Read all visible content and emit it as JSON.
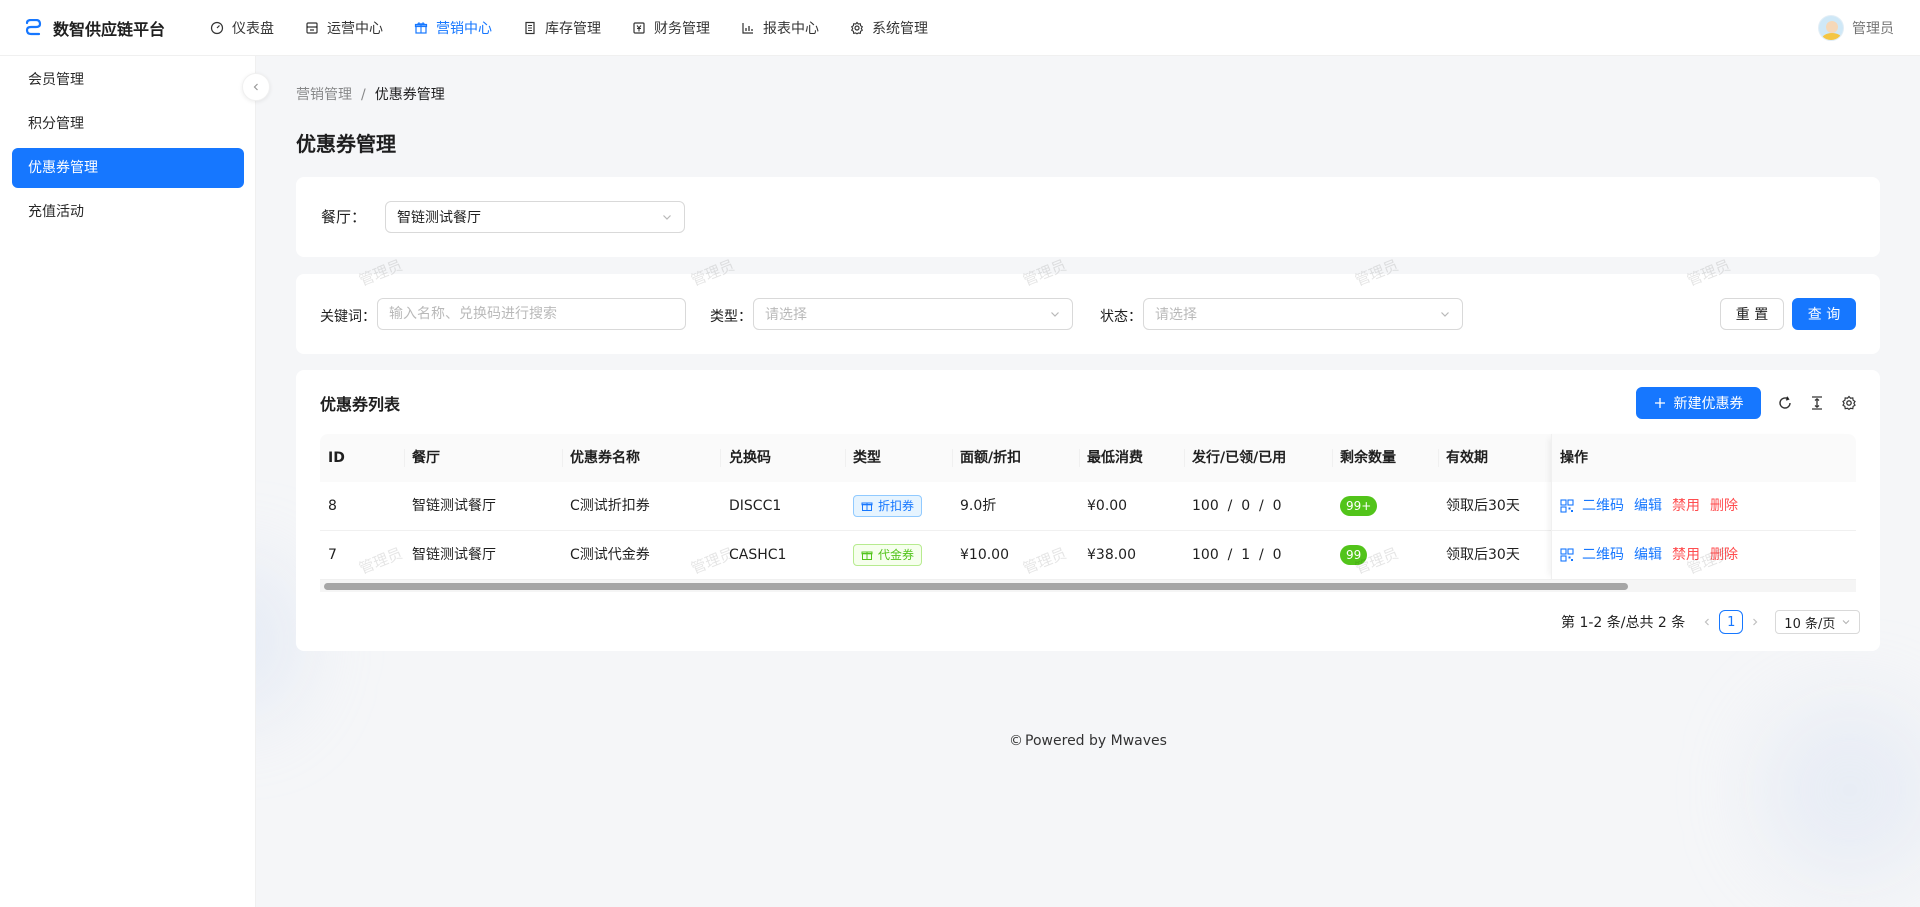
{
  "app": {
    "title": "数智供应链平台",
    "brand_color": "#1677ff"
  },
  "topnav": [
    {
      "label": "仪表盘",
      "icon": "dashboard-icon"
    },
    {
      "label": "运营中心",
      "icon": "store-icon"
    },
    {
      "label": "营销中心",
      "icon": "gift-icon",
      "active": true
    },
    {
      "label": "库存管理",
      "icon": "inventory-icon"
    },
    {
      "label": "财务管理",
      "icon": "finance-icon"
    },
    {
      "label": "报表中心",
      "icon": "chart-icon"
    },
    {
      "label": "系统管理",
      "icon": "gear-icon"
    }
  ],
  "user": {
    "name": "管理员"
  },
  "sidebar": {
    "items": [
      {
        "label": "会员管理"
      },
      {
        "label": "积分管理"
      },
      {
        "label": "优惠券管理",
        "active": true
      },
      {
        "label": "充值活动"
      }
    ]
  },
  "breadcrumb": {
    "parent": "营销管理",
    "separator": "/",
    "current": "优惠券管理"
  },
  "page_title": "优惠券管理",
  "restaurant_filter": {
    "label": "餐厅：",
    "value": "智链测试餐厅"
  },
  "search": {
    "keyword_label": "关键词：",
    "keyword_placeholder": "输入名称、兑换码进行搜索",
    "type_label": "类型：",
    "type_placeholder": "请选择",
    "status_label": "状态：",
    "status_placeholder": "请选择",
    "reset_label": "重 置",
    "query_label": "查 询"
  },
  "list": {
    "title": "优惠券列表",
    "new_button": "新建优惠券",
    "columns": [
      "ID",
      "餐厅",
      "优惠券名称",
      "兑换码",
      "类型",
      "面额/折扣",
      "最低消费",
      "发行/已领/已用",
      "剩余数量",
      "有效期",
      "操作"
    ],
    "rows": [
      {
        "id": "8",
        "restaurant": "智链测试餐厅",
        "name": "C测试折扣券",
        "code": "DISCC1",
        "type": "折扣券",
        "type_style": "blue",
        "amount": "9.0折",
        "min": "¥0.00",
        "stats": "100  /  0  /  0",
        "remain": "99+",
        "valid": "领取后30天"
      },
      {
        "id": "7",
        "restaurant": "智链测试餐厅",
        "name": "C测试代金券",
        "code": "CASHC1",
        "type": "代金券",
        "type_style": "green",
        "amount": "¥10.00",
        "min": "¥38.00",
        "stats": "100  /  1  /  0",
        "remain": "99",
        "valid": "领取后30天"
      }
    ],
    "actions": {
      "qr": "二维码",
      "edit": "编辑",
      "disable": "禁用",
      "delete": "删除"
    }
  },
  "pagination": {
    "summary": "第 1-2 条/总共 2 条",
    "current": "1",
    "page_size": "10 条/页"
  },
  "watermark": "管理员",
  "footer": {
    "text": "Powered by Mwaves",
    "symbol": "©"
  }
}
